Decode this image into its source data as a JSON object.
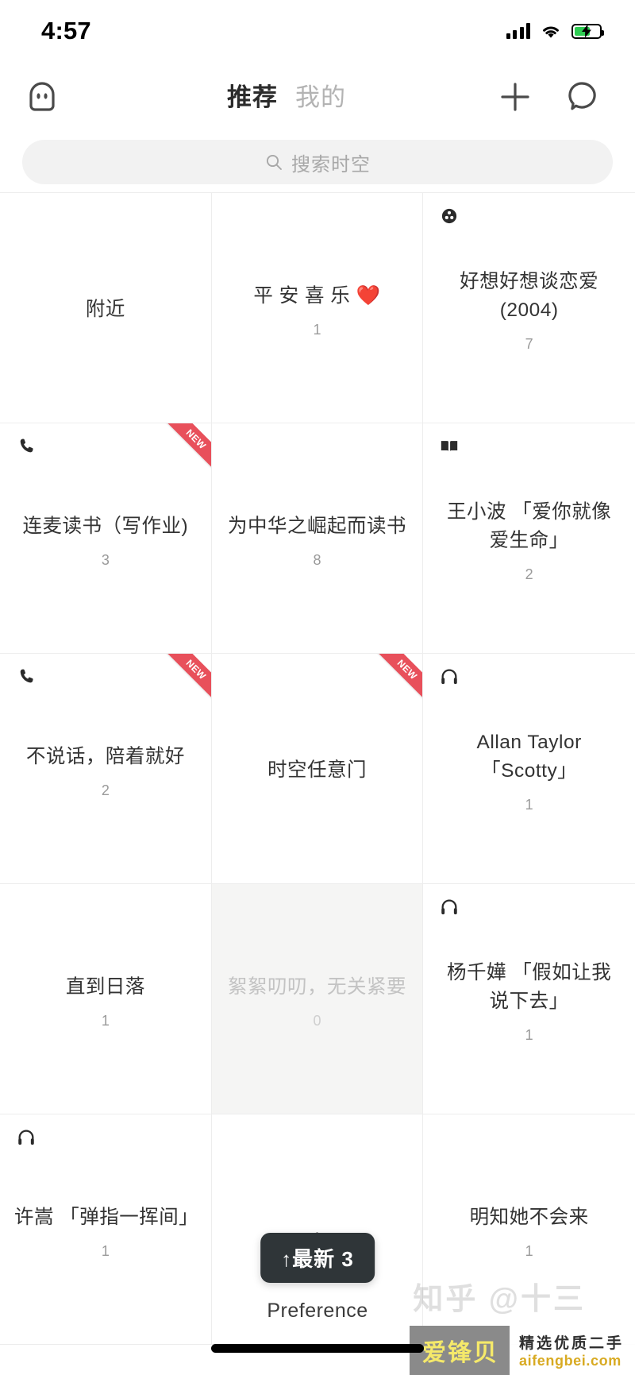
{
  "status_bar": {
    "time": "4:57",
    "signal_icon": "signal-bars-icon",
    "wifi_icon": "wifi-icon",
    "battery_icon": "battery-charging-icon",
    "battery_level_pct": 62
  },
  "nav": {
    "logo_icon": "ghost-mascot-icon",
    "tabs": [
      {
        "label": "推荐",
        "active": true
      },
      {
        "label": "我的",
        "active": false
      }
    ],
    "add_icon": "plus-icon",
    "message_icon": "speech-bubble-icon"
  },
  "search": {
    "placeholder": "搜索时空",
    "icon": "search-icon",
    "value": ""
  },
  "grid": {
    "cells": [
      {
        "title": "附近",
        "count": "",
        "icon": "",
        "new": false,
        "muted": false,
        "spaced": false
      },
      {
        "title": "平 安 喜 乐 ❤️",
        "count": "1",
        "icon": "",
        "new": false,
        "muted": false,
        "spaced": false
      },
      {
        "title": "好想好想谈恋爱(2004)",
        "count": "7",
        "icon": "film-reel-icon",
        "new": false,
        "muted": false,
        "spaced": false
      },
      {
        "title": "连麦读书（写作业)",
        "count": "3",
        "icon": "phone-icon",
        "new": true,
        "muted": false,
        "spaced": false
      },
      {
        "title": "为中华之崛起而读书",
        "count": "8",
        "icon": "",
        "new": false,
        "muted": false,
        "spaced": false
      },
      {
        "title": "王小波 「爱你就像爱生命」",
        "count": "2",
        "icon": "book-icon",
        "new": false,
        "muted": false,
        "spaced": false
      },
      {
        "title": "不说话，陪着就好",
        "count": "2",
        "icon": "phone-icon",
        "new": true,
        "muted": false,
        "spaced": false
      },
      {
        "title": "时空任意门",
        "count": "",
        "icon": "",
        "new": true,
        "muted": false,
        "spaced": false
      },
      {
        "title": "Allan Taylor 「Scotty」",
        "count": "1",
        "icon": "headphones-icon",
        "new": false,
        "muted": false,
        "spaced": false
      },
      {
        "title": "直到日落",
        "count": "1",
        "icon": "",
        "new": false,
        "muted": false,
        "spaced": false
      },
      {
        "title": "絮絮叨叨，无关紧要",
        "count": "0",
        "icon": "",
        "new": false,
        "muted": true,
        "spaced": false
      },
      {
        "title": "杨千嬅 「假如让我说下去」",
        "count": "1",
        "icon": "headphones-icon",
        "new": false,
        "muted": false,
        "spaced": false
      },
      {
        "title": "许嵩 「弹指一挥间」",
        "count": "1",
        "icon": "headphones-icon",
        "new": false,
        "muted": false,
        "spaced": false
      },
      {
        "title": "",
        "count": "1",
        "icon": "",
        "new": false,
        "muted": false,
        "spaced": false
      },
      {
        "title": "明知她不会来",
        "count": "1",
        "icon": "",
        "new": false,
        "muted": false,
        "spaced": false
      }
    ],
    "new_badge_label": "NEW"
  },
  "floating": {
    "newest_label": "↑最新 3",
    "preference_label": "Preference"
  },
  "watermark": {
    "site_cn": "爱锋贝",
    "tagline": "精选优质二手",
    "domain": "aifengbei.com",
    "overlay": "知乎 @十三"
  },
  "colors": {
    "accent_red": "#e8505b",
    "pill_dark": "#2f3538",
    "battery_green": "#2ecc52",
    "muted_text": "#c3c3c3",
    "divider": "#ededed"
  }
}
